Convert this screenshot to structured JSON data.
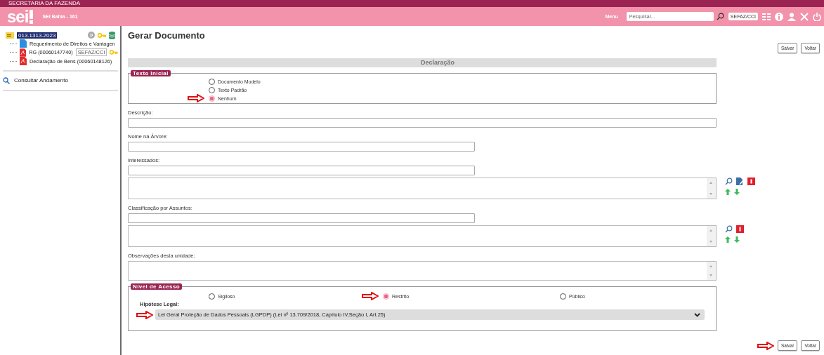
{
  "header": {
    "org": "SECRETARIA DA FAZENDA",
    "logo": "sei",
    "system": "SEI Bahia - 161",
    "menu": "Menu",
    "search": {
      "placeholder": "Pesquisar..."
    },
    "unit": "SEFAZ/CCI"
  },
  "sidebar": {
    "tree": {
      "label": "013.1313.2023",
      "selected": true,
      "children": [
        {
          "label": "Requerimento de Direitos e Vantagen",
          "kind": "doc"
        },
        {
          "label": "RG (00060147740)",
          "kind": "pdf",
          "tag": "SEFAZ/CCI",
          "key": true
        },
        {
          "label": "Declaração de Bens (00060148126)",
          "kind": "pdf"
        }
      ]
    },
    "links": [
      "Consultar Andamento"
    ]
  },
  "main": {
    "title": "Gerar Documento",
    "top_buttons": [
      "Salvar",
      "Voltar"
    ],
    "section": "Declaração",
    "texto_inicial": {
      "legend": "Texto Inicial",
      "options": [
        {
          "label": "Documento Modelo",
          "selected": false
        },
        {
          "label": "Texto Padrão",
          "selected": false
        },
        {
          "label": "Nenhum",
          "selected": true
        }
      ]
    },
    "fields": [
      {
        "label": "Descrição:",
        "kind": "line"
      },
      {
        "label": "Nome na Árvore:",
        "kind": "short"
      },
      {
        "label": "Interessados:",
        "kind": "picker",
        "editable": true
      },
      {
        "label": "Classificação por Assuntos:",
        "kind": "picker",
        "editable": false
      },
      {
        "label": "Observações desta unidade:",
        "kind": "memo"
      }
    ],
    "nivel_acesso": {
      "legend": "Nível de Acesso",
      "options": [
        {
          "label": "Sigiloso",
          "selected": false
        },
        {
          "label": "Restrito",
          "selected": true
        },
        {
          "label": "Público",
          "selected": false
        }
      ],
      "hipotese_label": "Hipótese Legal:",
      "hipotese_value": "Lei Geral Proteção de Dados Pessoais (LGPDP) (Lei nº 13.709/2018, Capítulo IV,Seção I, Art.25)"
    },
    "bottom_buttons": [
      "Salvar",
      "Voltar"
    ]
  }
}
